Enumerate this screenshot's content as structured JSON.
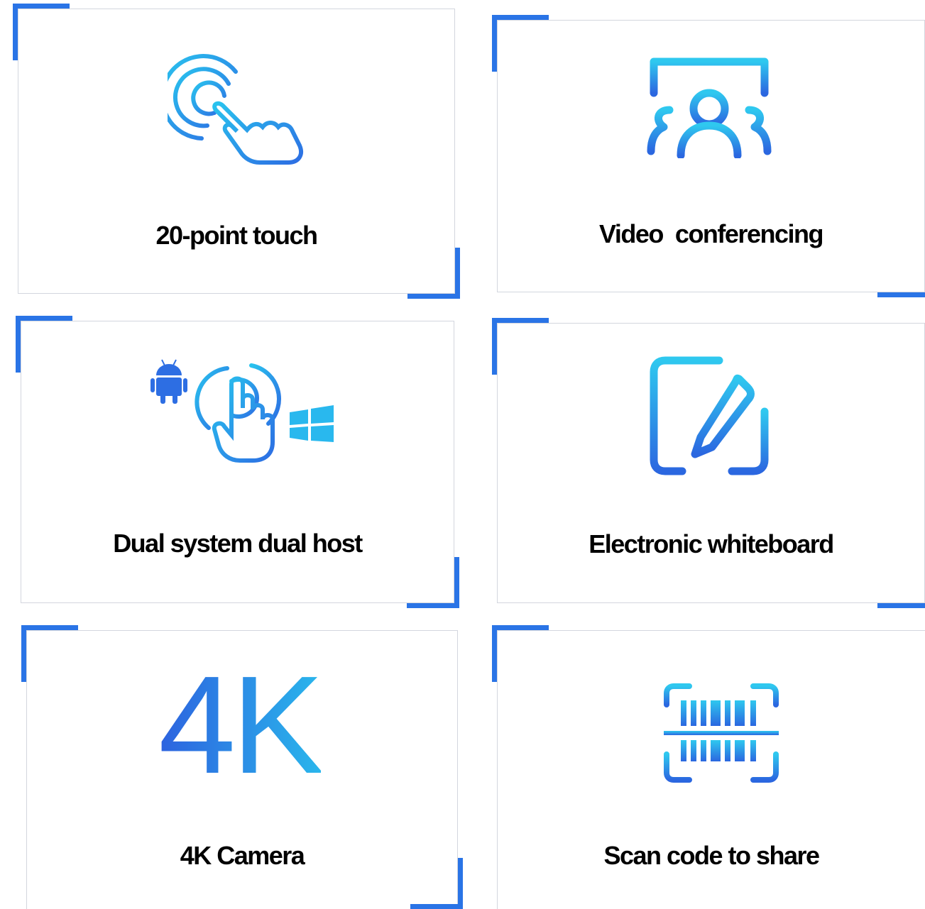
{
  "colors": {
    "accent": "#2a74e6",
    "icon_light": "#29c3ee",
    "icon_dark": "#2d6ee3",
    "border": "#d3d6de"
  },
  "features": [
    {
      "label": "20-point touch",
      "icon": "multi-touch-hand-icon"
    },
    {
      "label": "Video  conferencing",
      "icon": "video-conference-group-icon"
    },
    {
      "label": "Dual system dual host",
      "icon": "dual-system-android-windows-icon"
    },
    {
      "label": "Electronic whiteboard",
      "icon": "whiteboard-pen-icon"
    },
    {
      "label": "4K Camera",
      "icon": "4k-icon",
      "icon_text": "4K"
    },
    {
      "label": "Scan code to share",
      "icon": "barcode-scan-icon"
    }
  ]
}
